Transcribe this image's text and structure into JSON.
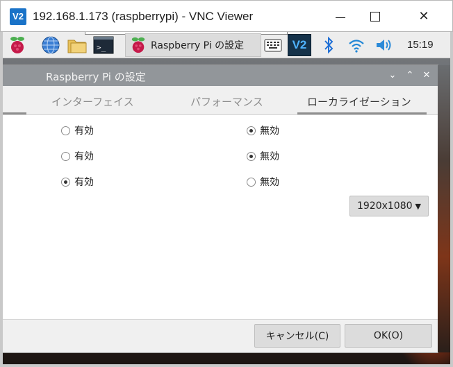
{
  "viewer": {
    "logo": "V2",
    "title": "192.168.1.173 (raspberrypi) - VNC Viewer",
    "minimize": "—",
    "maximize": "☐",
    "close": "✕"
  },
  "taskbar": {
    "icons": [
      "raspberry-menu-icon",
      "browser-globe-icon",
      "file-manager-icon",
      "terminal-icon",
      "keyboard-icon",
      "vnc-icon",
      "bluetooth-icon",
      "wifi-icon",
      "volume-icon"
    ],
    "terminal_glyph": ">_",
    "vnc_glyph": "V2",
    "task_label": "Raspberry Pi の設定",
    "clock": "15:19"
  },
  "dialog": {
    "title": "Raspberry Pi の設定",
    "controls": {
      "minimize": "⌄",
      "maximize": "⌃",
      "close": "✕"
    },
    "tabs": [
      {
        "label": "インターフェイス",
        "active": false
      },
      {
        "label": "パフォーマンス",
        "active": false
      },
      {
        "label": "ローカライゼーション",
        "active": true
      }
    ],
    "options": [
      {
        "enable_label": "有効",
        "disable_label": "無効",
        "value": "disable"
      },
      {
        "enable_label": "有効",
        "disable_label": "無効",
        "value": "disable"
      },
      {
        "enable_label": "有効",
        "disable_label": "無効",
        "value": "enable"
      }
    ],
    "resolution": {
      "value": "1920x1080",
      "arrow": "▼"
    },
    "buttons": {
      "cancel": "キャンセル(C)",
      "ok": "OK(O)"
    }
  }
}
